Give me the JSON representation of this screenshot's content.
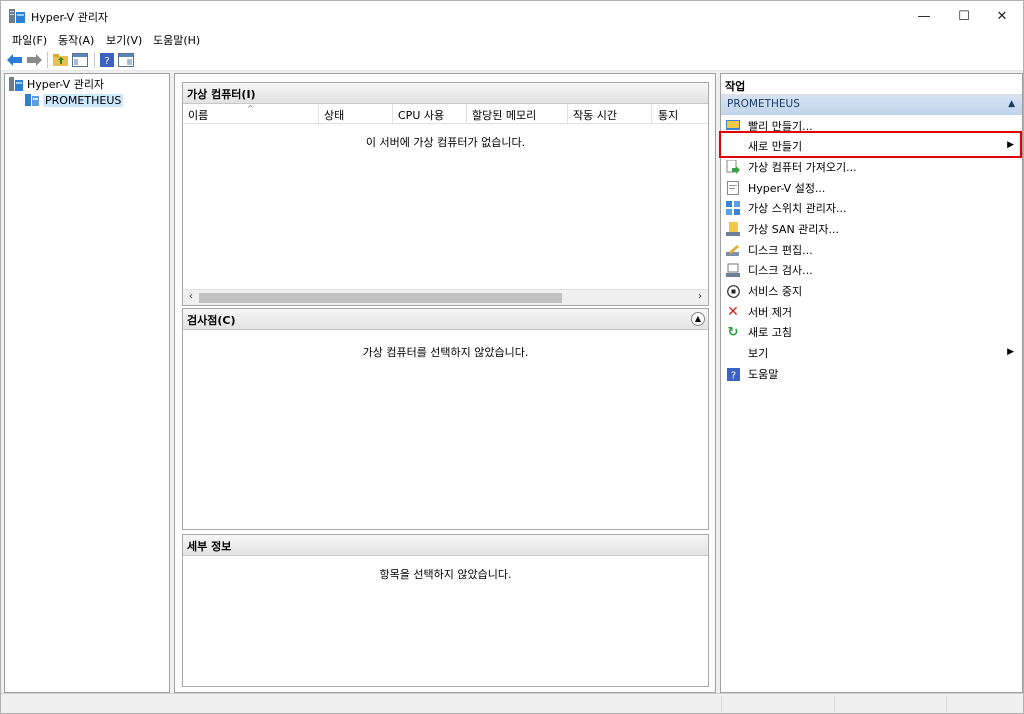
{
  "window": {
    "title": "Hyper-V 관리자",
    "min": "—",
    "max": "☐",
    "close": "✕"
  },
  "menu": [
    "파일(F)",
    "동작(A)",
    "보기(V)",
    "도움말(H)"
  ],
  "tree": {
    "root": "Hyper-V 관리자",
    "server": "PROMETHEUS"
  },
  "vm_panel": {
    "title": "가상 컴퓨터(I)",
    "columns": [
      "이름",
      "상태",
      "CPU 사용",
      "할당된 메모리",
      "작동 시간",
      "통지"
    ],
    "empty": "이 서버에 가상 컴퓨터가 없습니다."
  },
  "checkpoint_panel": {
    "title": "검사점(C)",
    "empty": "가상 컴퓨터를 선택하지 않았습니다."
  },
  "details_panel": {
    "title": "세부 정보",
    "empty": "항목을 선택하지 않았습니다."
  },
  "actions": {
    "header": "작업",
    "section": "PROMETHEUS",
    "items": [
      {
        "label": "빨리 만들기...",
        "icon": "quick-create-icon"
      },
      {
        "label": "새로 만들기",
        "icon": "",
        "submenu": true
      },
      {
        "label": "가상 컴퓨터 가져오기...",
        "icon": "import-vm-icon"
      },
      {
        "label": "Hyper-V 설정...",
        "icon": "settings-icon"
      },
      {
        "label": "가상 스위치 관리자...",
        "icon": "virtual-switch-icon"
      },
      {
        "label": "가상 SAN 관리자...",
        "icon": "san-icon"
      },
      {
        "label": "디스크 편집...",
        "icon": "edit-disk-icon"
      },
      {
        "label": "디스크 검사...",
        "icon": "inspect-disk-icon"
      },
      {
        "label": "서비스 중지",
        "icon": "stop-icon"
      },
      {
        "label": "서버 제거",
        "icon": "remove-icon"
      },
      {
        "label": "새로 고침",
        "icon": "refresh-icon"
      },
      {
        "label": "보기",
        "icon": "",
        "submenu": true
      },
      {
        "label": "도움말",
        "icon": "help-icon"
      }
    ]
  }
}
